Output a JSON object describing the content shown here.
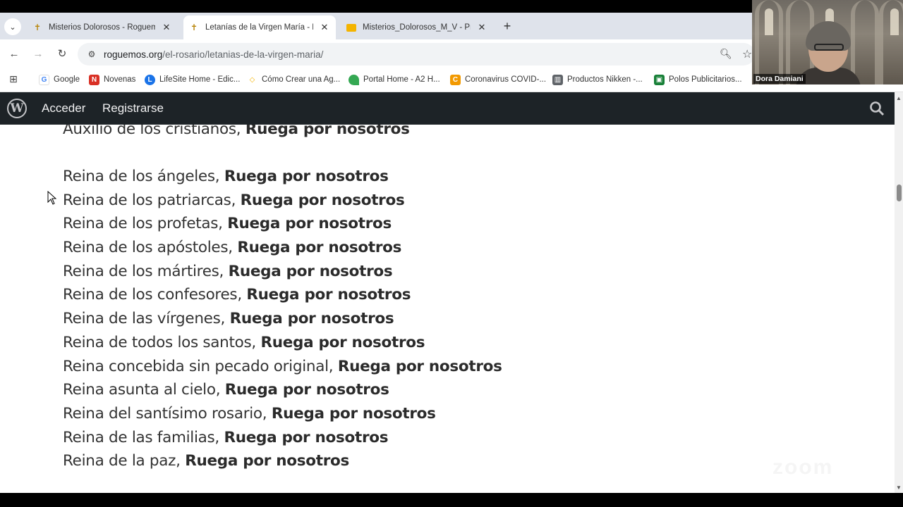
{
  "tabs": [
    {
      "title": "Misterios Dolorosos - Roguemos",
      "favicon": "rosary-icon",
      "active": false
    },
    {
      "title": "Letanías de la Virgen María - Roguemos",
      "favicon": "rosary-icon",
      "active": true
    },
    {
      "title": "Misterios_Dolorosos_M_V - Presentaciones",
      "favicon": "slides-icon",
      "active": false
    }
  ],
  "tab_close_glyph": "✕",
  "new_tab_glyph": "+",
  "address": {
    "host": "roguemos.org",
    "path": "/el-rosario/letanias-de-la-virgen-maria/"
  },
  "bookmarks": [
    {
      "label": "Google",
      "favicon": "google-icon",
      "color": "#4285f4"
    },
    {
      "label": "Novenas",
      "favicon": "novenas-icon",
      "color": "#d93025"
    },
    {
      "label": "LifeSite Home - Edic...",
      "favicon": "lifesite-icon",
      "color": "#1a73e8"
    },
    {
      "label": "Cómo Crear una Ag...",
      "favicon": "diamond-icon",
      "color": "#f4b400"
    },
    {
      "label": "Portal Home - A2 H...",
      "favicon": "a2-icon",
      "color": "#34a853"
    },
    {
      "label": "Coronavirus COVID-...",
      "favicon": "covid-icon",
      "color": "#f29900"
    },
    {
      "label": "Productos Nikken -...",
      "favicon": "store-icon",
      "color": "#5f6368"
    },
    {
      "label": "Polos Publicitarios...",
      "favicon": "polo-icon",
      "color": "#188038"
    }
  ],
  "video": {
    "participant_name": "Dora Damiani"
  },
  "wpbar": {
    "login": "Acceder",
    "register": "Registrarse"
  },
  "litany": [
    {
      "invocation": "Auxilio de los cristianos,",
      "response": "Ruega por nosotros"
    },
    {
      "invocation": "Reina de los ángeles,",
      "response": "Ruega por nosotros"
    },
    {
      "invocation": "Reina de los patriarcas,",
      "response": "Ruega por nosotros"
    },
    {
      "invocation": "Reina de los profetas,",
      "response": "Ruega por nosotros"
    },
    {
      "invocation": "Reina de los apóstoles,",
      "response": "Ruega por nosotros"
    },
    {
      "invocation": "Reina de los mártires,",
      "response": "Ruega por nosotros"
    },
    {
      "invocation": "Reina de los confesores,",
      "response": "Ruega por nosotros"
    },
    {
      "invocation": "Reina de las vírgenes,",
      "response": "Ruega por nosotros"
    },
    {
      "invocation": "Reina de todos los santos,",
      "response": "Ruega por nosotros"
    },
    {
      "invocation": "Reina concebida sin pecado original,",
      "response": "Ruega por nosotros"
    },
    {
      "invocation": "Reina asunta al cielo,",
      "response": "Ruega por nosotros"
    },
    {
      "invocation": "Reina del santísimo rosario,",
      "response": "Ruega por nosotros"
    },
    {
      "invocation": "Reina de las familias,",
      "response": "Ruega por nosotros"
    },
    {
      "invocation": "Reina de la paz,",
      "response": "Ruega por nosotros"
    }
  ],
  "watermark": "zoom"
}
